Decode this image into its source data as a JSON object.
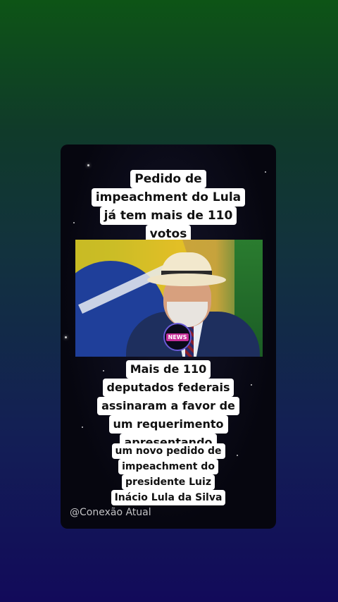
{
  "headline": {
    "lines": [
      "Pedido de",
      "impeachment do Lula",
      "já tem mais de 110",
      "votos"
    ]
  },
  "body": {
    "lines_large": [
      "Mais de 110",
      "deputados federais",
      "assinaram  a favor de",
      "um requerimento",
      "apresentando"
    ],
    "lines_small": [
      "um novo pedido de",
      "impeachment do",
      "presidente Luiz",
      "Inácio Lula da Silva"
    ]
  },
  "photo": {
    "badge_text": "NEWS"
  },
  "watermark": "@Conexão Atual"
}
